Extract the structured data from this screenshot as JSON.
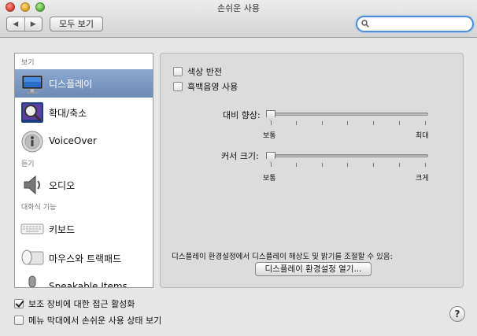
{
  "window": {
    "title": "손쉬운 사용"
  },
  "toolbar": {
    "back_glyph": "◀",
    "forward_glyph": "▶",
    "show_all_label": "모두 보기",
    "search_placeholder": ""
  },
  "sidebar": {
    "sections": [
      {
        "header": "보기",
        "items": [
          {
            "label": "디스플레이",
            "icon": "display-icon",
            "selected": true
          },
          {
            "label": "확대/축소",
            "icon": "zoom-icon",
            "selected": false
          },
          {
            "label": "VoiceOver",
            "icon": "voiceover-icon",
            "selected": false
          }
        ]
      },
      {
        "header": "듣기",
        "items": [
          {
            "label": "오디오",
            "icon": "speaker-icon",
            "selected": false
          }
        ]
      },
      {
        "header": "대화식 기능",
        "items": [
          {
            "label": "키보드",
            "icon": "keyboard-icon",
            "selected": false
          },
          {
            "label": "마우스와 트랙패드",
            "icon": "mouse-trackpad-icon",
            "selected": false
          },
          {
            "label": "Speakable Items",
            "icon": "microphone-icon",
            "selected": false
          }
        ]
      }
    ]
  },
  "display_pane": {
    "invert_colors_label": "색상 반전",
    "invert_colors_checked": false,
    "grayscale_label": "흑백음영 사용",
    "grayscale_checked": false,
    "contrast_label": "대비 향상:",
    "contrast_min_label": "보통",
    "contrast_max_label": "최대",
    "contrast_value": 0,
    "cursor_label": "커서 크기:",
    "cursor_min_label": "보통",
    "cursor_max_label": "크게",
    "cursor_value": 0,
    "info_text": "디스플레이 환경설정에서 디스플레이 해상도 및 밝기를 조절할 수 있음:",
    "open_prefs_button": "디스플레이 환경설정 열기..."
  },
  "footer": {
    "assistive_label": "보조 장비에 대한 접근 활성화",
    "assistive_checked": true,
    "menubar_label": "메뉴 막대에서 손쉬운 사용 상태 보기",
    "menubar_checked": false,
    "help_glyph": "?"
  },
  "colors": {
    "selection": "#7a96c2",
    "search_focus": "#4f8fd8"
  }
}
